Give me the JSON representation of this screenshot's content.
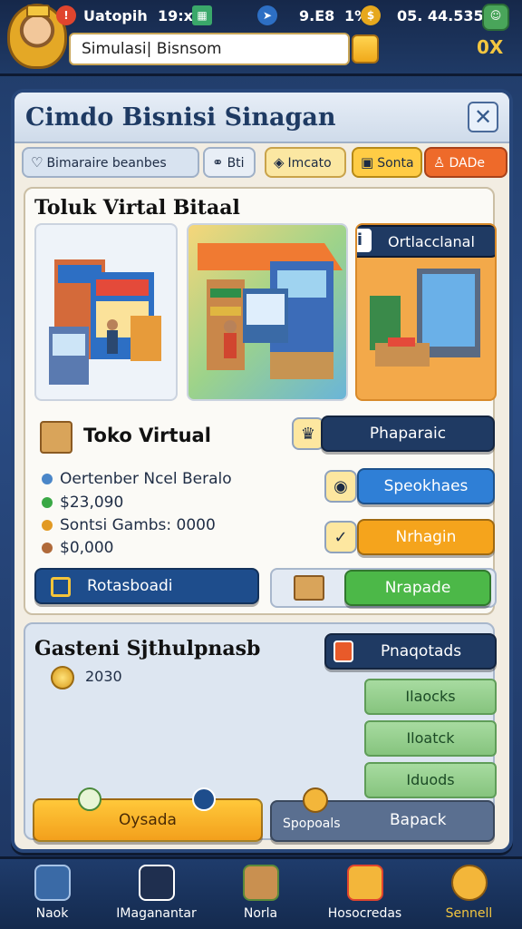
{
  "status_bar": {
    "app_name": "Uatopih",
    "time": "19:x",
    "signal": "9.E8",
    "battery_pct": "1%",
    "coins": "05. 44.535",
    "corner_label": "0X"
  },
  "search": {
    "value": "Simulasi| Bisnsom"
  },
  "panel": {
    "title": "Cimdo Bisnisi Sinagan",
    "close_label": "✕"
  },
  "tabs": [
    {
      "label": "Bimaraire beanbes"
    },
    {
      "label": "Bti"
    },
    {
      "label": "Imcato"
    },
    {
      "label": "Sonta"
    },
    {
      "label": "DADe"
    }
  ],
  "toko": {
    "section_title": "Toluk Virtal Bitaal",
    "scene_badge": "Ortlacclanal",
    "name": "Toko Virtual",
    "stats": [
      {
        "text": "Oertenber Ncel Beralo",
        "color": "#4a86c8"
      },
      {
        "text": "$23,090",
        "color": "#3aa845"
      },
      {
        "text": "Sontsi Gambs: 0000",
        "color": "#e29a24"
      },
      {
        "text": "$0,000",
        "color": "#b06a3a"
      }
    ],
    "buttons": {
      "phaparaic": "Phaparaic",
      "speokhaes": "Speokhaes",
      "nrhagin": "Nrhagin",
      "rotasboadi": "Rotasboadi",
      "nrapade": "Nrapade"
    }
  },
  "lower": {
    "title": "Gasteni Sjthulpnasb",
    "coin_value": "2030",
    "badge_button": "Pnaqotads",
    "list_buttons": [
      "Ilaocks",
      "Iloatck",
      "Iduods"
    ],
    "oysada": "Oysada",
    "spopoals": "Spopoals",
    "bapack": "Bapack"
  },
  "bottom_nav": [
    {
      "label": "Naok"
    },
    {
      "label": "IMaganantar"
    },
    {
      "label": "Norla"
    },
    {
      "label": "Hosocredas"
    },
    {
      "label": "Sennell"
    }
  ],
  "colors": {
    "primary_blue": "#1e4d8c",
    "accent_orange": "#f5a41c",
    "accent_green": "#4cb848"
  }
}
